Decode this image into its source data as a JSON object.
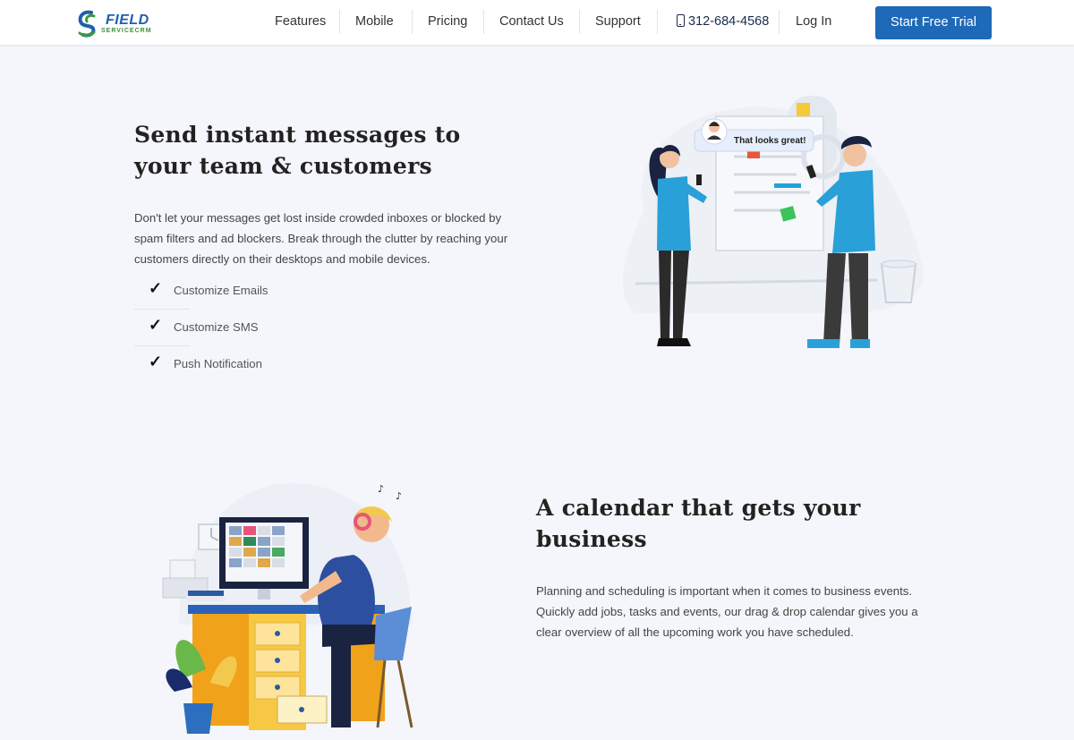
{
  "header": {
    "logo": {
      "line1": "FIELD",
      "line2": "SERVICECRM"
    },
    "nav": [
      {
        "label": "Features"
      },
      {
        "label": "Mobile"
      },
      {
        "label": "Pricing"
      },
      {
        "label": "Contact Us"
      },
      {
        "label": "Support"
      }
    ],
    "phone": "312-684-4568",
    "login": "Log In",
    "cta": "Start Free Trial"
  },
  "messaging": {
    "title": "Send instant messages to your team & customers",
    "description": "Don't let your messages get lost inside crowded inboxes or blocked by spam filters and ad blockers. Break through the clutter by reaching your customers directly on their desktops and mobile devices.",
    "features": [
      "Customize Emails",
      "Customize SMS",
      "Push Notification"
    ],
    "chat_bubble": "That looks great!"
  },
  "calendar": {
    "title": "A calendar that gets your business",
    "description": "Planning and scheduling is important when it comes to business events. Quickly add jobs, tasks and events, our drag & drop calendar gives you a clear overview of all the upcoming work you have scheduled."
  },
  "colors": {
    "accent": "#1e69b8",
    "page_bg": "#f4f6fb",
    "logo_blue": "#1f5fae",
    "logo_green": "#3a8f3a"
  }
}
